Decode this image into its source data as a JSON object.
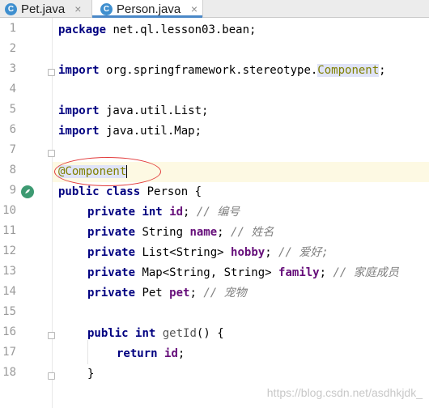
{
  "tabs": [
    {
      "label": "Pet.java",
      "icon": "C",
      "close": "×"
    },
    {
      "label": "Person.java",
      "icon": "C",
      "close": "×"
    }
  ],
  "line_numbers": [
    "1",
    "2",
    "3",
    "4",
    "5",
    "6",
    "7",
    "8",
    "9",
    "10",
    "11",
    "12",
    "13",
    "14",
    "15",
    "16",
    "17",
    "18"
  ],
  "code": {
    "l1": {
      "kw": "package",
      "rest": " net.ql.lesson03.bean;"
    },
    "l3": {
      "kw": "import",
      "rest": " org.springframework.stereotype.",
      "anno": "Component",
      "end": ";"
    },
    "l5": {
      "kw": "import",
      "rest": " java.util.List;"
    },
    "l6": {
      "kw": "import",
      "rest": " java.util.Map;"
    },
    "l8": {
      "anno": "@Component"
    },
    "l9": {
      "kw": "public class",
      "rest": " Person {"
    },
    "l10": {
      "kw1": "private",
      "kw2": "int",
      "field": "id",
      "cmt": "// 编号"
    },
    "l11": {
      "kw": "private",
      "type": " String ",
      "field": "name",
      "cmt": "// 姓名"
    },
    "l12": {
      "kw": "private",
      "type": " List<String> ",
      "field": "hobby",
      "cmt": "// 爱好;"
    },
    "l13": {
      "kw": "private",
      "type": " Map<String, String> ",
      "field": "family",
      "cmt": "// 家庭成员"
    },
    "l14": {
      "kw": "private",
      "type": " Pet ",
      "field": "pet",
      "cmt": "// 宠物"
    },
    "l16": {
      "kw1": "public",
      "kw2": "int",
      "method": "getId",
      "rest": "() {"
    },
    "l17": {
      "kw": "return",
      "field": "id",
      "end": ";"
    },
    "l18": {
      "text": "}"
    }
  },
  "watermark": "https://blog.csdn.net/asdhkjdk_",
  "colors": {
    "keyword": "#000080",
    "field": "#660e7a",
    "comment": "#808080",
    "annotation": "#808000",
    "highlight_circle": "#e23b3b"
  }
}
